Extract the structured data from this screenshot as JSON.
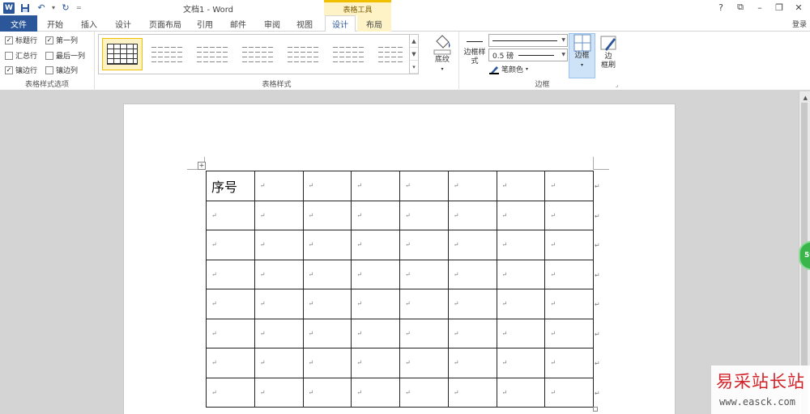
{
  "titlebar": {
    "app_logo": "W",
    "doc_title": "文档1 - Word",
    "context_group": "表格工具",
    "controls": [
      "?",
      "⧉",
      "–",
      "❐",
      "✕"
    ],
    "icons": [
      "save-icon",
      "undo-icon",
      "redo-icon"
    ]
  },
  "tabs": {
    "file": "文件",
    "home": "开始",
    "insert": "插入",
    "design": "设计",
    "layout_page": "页面布局",
    "references": "引用",
    "mailings": "邮件",
    "review": "审阅",
    "view": "视图",
    "table_design": "设计",
    "table_layout": "布局",
    "login": "登录"
  },
  "ribbon": {
    "style_options": {
      "label": "表格样式选项",
      "header_row": "标题行",
      "first_column": "第一列",
      "total_row": "汇总行",
      "last_column": "最后一列",
      "banded_rows": "镶边行",
      "banded_columns": "镶边列",
      "checked": {
        "header_row": true,
        "first_column": true,
        "total_row": false,
        "last_column": false,
        "banded_rows": true,
        "banded_columns": false
      }
    },
    "table_styles": {
      "label": "表格样式",
      "shading": "底纹",
      "scroll": [
        "▲",
        "▼",
        "▾"
      ]
    },
    "borders": {
      "label": "边框",
      "border_style_line1": "边框样",
      "border_style_line2": "式",
      "weight": "0.5 磅",
      "pen_color": "笔颜色",
      "borders_btn": "边框",
      "painter_line1": "边",
      "painter_line2": "框刷"
    }
  },
  "document": {
    "first_cell": "序号",
    "cell_mark": "↵",
    "rows": 8,
    "cols": 8
  },
  "overlay": {
    "green_badge": "59",
    "watermark_cn": "易采站长站",
    "watermark_en": "www.easck.com"
  },
  "colors": {
    "word_blue": "#2b579a",
    "context_yellow": "#fdf3c7",
    "badge_green": "#39b54a",
    "watermark_red": "#d2232a"
  }
}
